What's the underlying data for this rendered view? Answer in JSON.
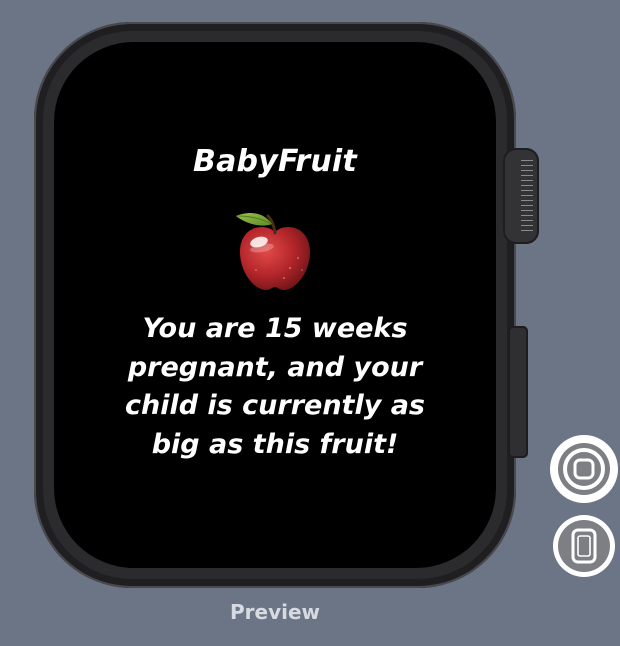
{
  "watch": {
    "app_title": "BabyFruit",
    "fruit_icon": "apple",
    "message": "You are 15 weeks pregnant, and your child is currently as big as this fruit!"
  },
  "preview": {
    "label": "Preview",
    "home_control_icon": "home-button-icon",
    "device_control_icon": "device-icon"
  },
  "colors": {
    "background": "#6b7585",
    "screen": "#000000",
    "text": "#ffffff",
    "apple_red": "#b3262b",
    "leaf_green": "#7aa33a"
  }
}
